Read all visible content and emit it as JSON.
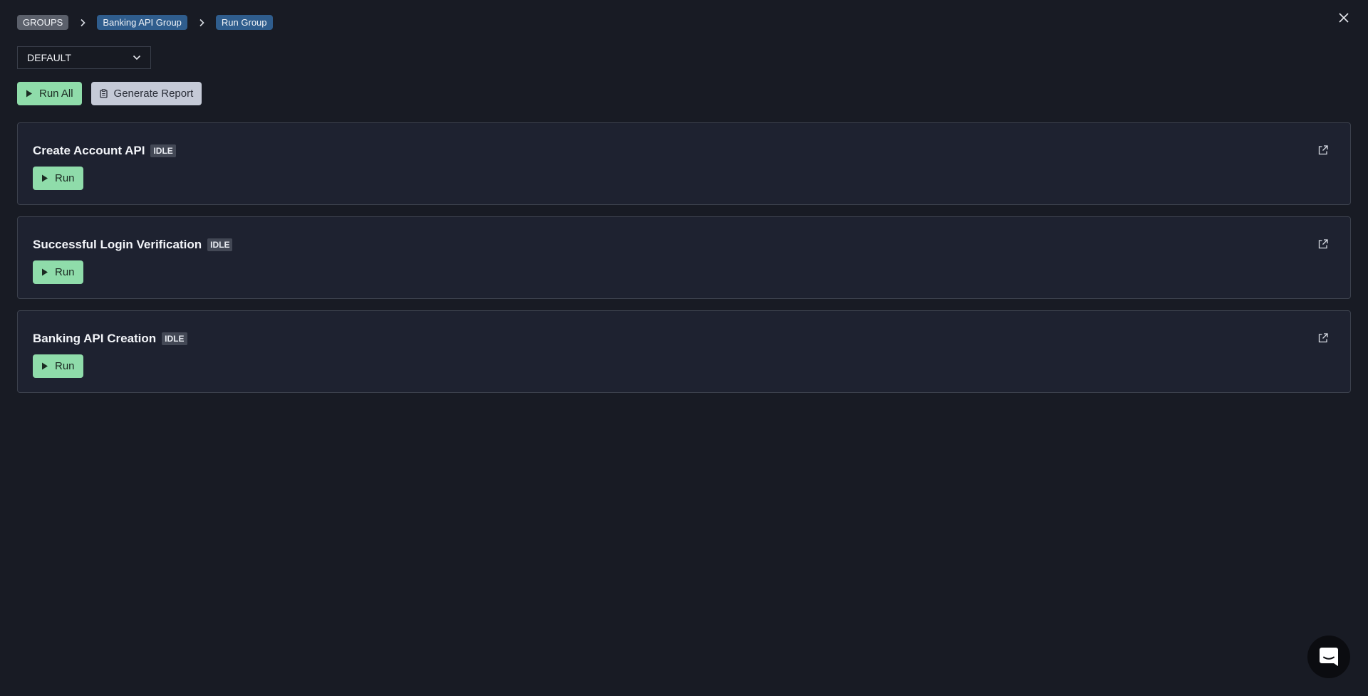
{
  "breadcrumb": {
    "items": [
      "GROUPS",
      "Banking API Group",
      "Run Group"
    ]
  },
  "environment_select": {
    "value": "DEFAULT"
  },
  "actions": {
    "run_all_label": "Run All",
    "generate_report_label": "Generate Report"
  },
  "tests": [
    {
      "name": "Create Account API",
      "status": "IDLE",
      "run_label": "Run"
    },
    {
      "name": "Successful Login Verification",
      "status": "IDLE",
      "run_label": "Run"
    },
    {
      "name": "Banking API Creation",
      "status": "IDLE",
      "run_label": "Run"
    }
  ],
  "colors": {
    "background": "#181b24",
    "card": "#1e2230",
    "run_green": "#8fdcaa",
    "report_grey": "#c5cad7",
    "crumb_blue": "#2f5d8d",
    "crumb_grey": "#5b606b"
  },
  "icons": {
    "close": "close-icon",
    "chevron": "chevron-down-icon",
    "play": "play-icon",
    "report": "clipboard-icon",
    "open": "external-link-icon",
    "chat": "chat-icon"
  }
}
